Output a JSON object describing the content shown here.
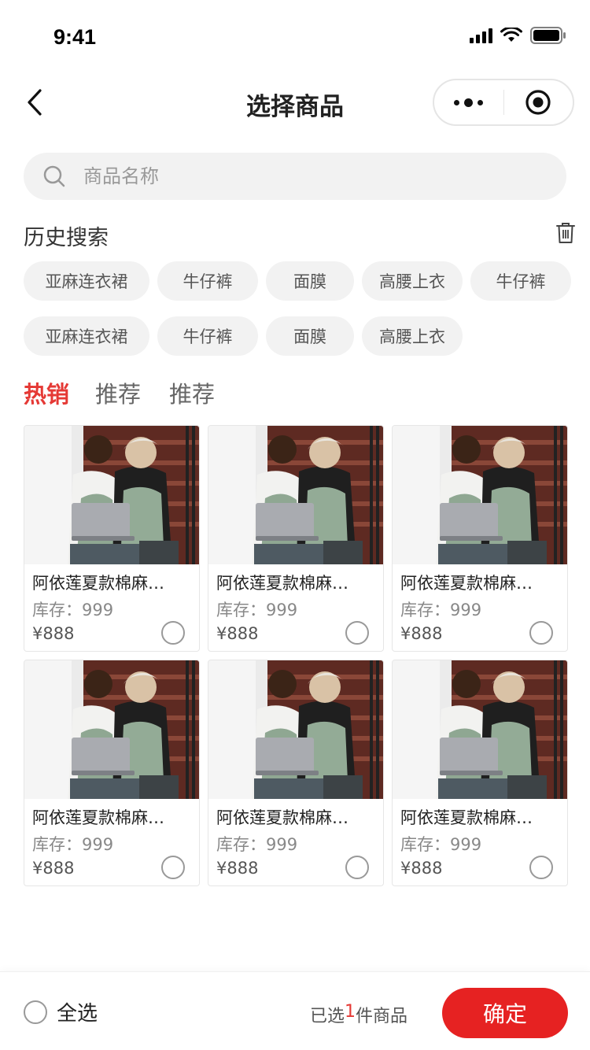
{
  "status_bar": {
    "time": "9:41"
  },
  "nav": {
    "title": "选择商品"
  },
  "search": {
    "placeholder": "商品名称"
  },
  "history": {
    "title": "历史搜索",
    "tags": [
      "亚麻连衣裙",
      "牛仔裤",
      "面膜",
      "高腰上衣",
      "牛仔裤",
      "亚麻连衣裙",
      "牛仔裤",
      "面膜",
      "高腰上衣"
    ]
  },
  "tabs": [
    {
      "label": "热销",
      "active": true
    },
    {
      "label": "推荐",
      "active": false
    },
    {
      "label": "推荐",
      "active": false
    }
  ],
  "products": [
    {
      "name": "阿依莲夏款棉麻…",
      "stock": "库存：999",
      "price": "¥888"
    },
    {
      "name": "阿依莲夏款棉麻…",
      "stock": "库存：999",
      "price": "¥888"
    },
    {
      "name": "阿依莲夏款棉麻…",
      "stock": "库存：999",
      "price": "¥888"
    },
    {
      "name": "阿依莲夏款棉麻…",
      "stock": "库存：999",
      "price": "¥888"
    },
    {
      "name": "阿依莲夏款棉麻…",
      "stock": "库存：999",
      "price": "¥888"
    },
    {
      "name": "阿依莲夏款棉麻…",
      "stock": "库存：999",
      "price": "¥888"
    }
  ],
  "footer": {
    "select_all": "全选",
    "selected_prefix": "已选",
    "selected_count": "1",
    "selected_suffix": "件商品",
    "confirm": "确定"
  },
  "colors": {
    "accent": "#e53935",
    "confirm": "#e62222",
    "tag_bg": "#f2f2f2"
  },
  "icons": [
    "back-arrow-icon",
    "more-dots-icon",
    "mini-program-close-icon",
    "search-icon",
    "trash-icon",
    "radio-icon"
  ]
}
